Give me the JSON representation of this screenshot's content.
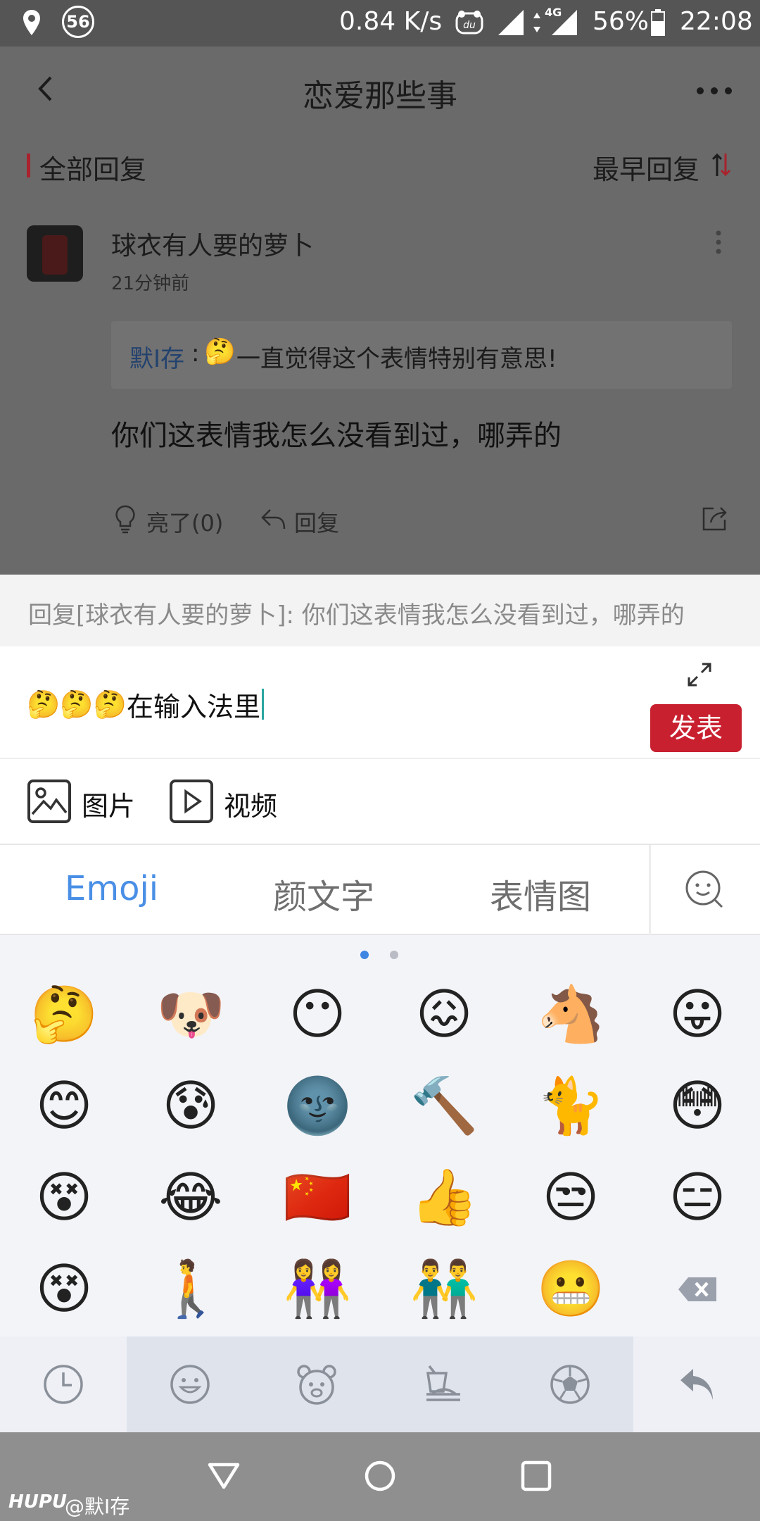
{
  "status_bar": {
    "notification_count": "56",
    "speed": "0.84 K/s",
    "network": "4G",
    "battery": "56%",
    "time": "22:08"
  },
  "header": {
    "title": "恋爱那些事"
  },
  "sort_bar": {
    "section_label": "全部回复",
    "sort_label": "最早回复"
  },
  "comment": {
    "username": "球衣有人要的萝卜",
    "time": "21分钟前",
    "quote_user": "默I存",
    "quote_sep": ":",
    "quote_emoji": "🤔",
    "quote_text": "一直觉得这个表情特别有意思!",
    "body": "你们这表情我怎么没看到过，哪弄的",
    "like_label": "亮了(0)",
    "reply_label": "回复"
  },
  "reply_panel": {
    "hint": "回复[球衣有人要的萝卜]: 你们这表情我怎么没看到过，哪弄的",
    "input_emojis": "🤔🤔🤔",
    "input_text": "在输入法里",
    "send_label": "发表"
  },
  "attach": {
    "image_label": "图片",
    "video_label": "视频"
  },
  "emoji_tabs": [
    "Emoji",
    "颜文字",
    "表情图"
  ],
  "emoji_grid": [
    "🤔",
    "🐶",
    "😶",
    "😖",
    "🐴",
    "😛",
    "😊",
    "😰",
    "🌚",
    "🔨",
    "🐈",
    "😳",
    "😵",
    "😂",
    "🇨🇳",
    "👍",
    "😒",
    "😑",
    "😵",
    "🚶",
    "👭",
    "👬",
    "😬"
  ],
  "watermark": {
    "brand": "HUPU",
    "handle": "@默I存"
  },
  "colors": {
    "accent_blue": "#4a8fe6",
    "send_red": "#c8202f",
    "section_marker_red": "#c8202f"
  }
}
